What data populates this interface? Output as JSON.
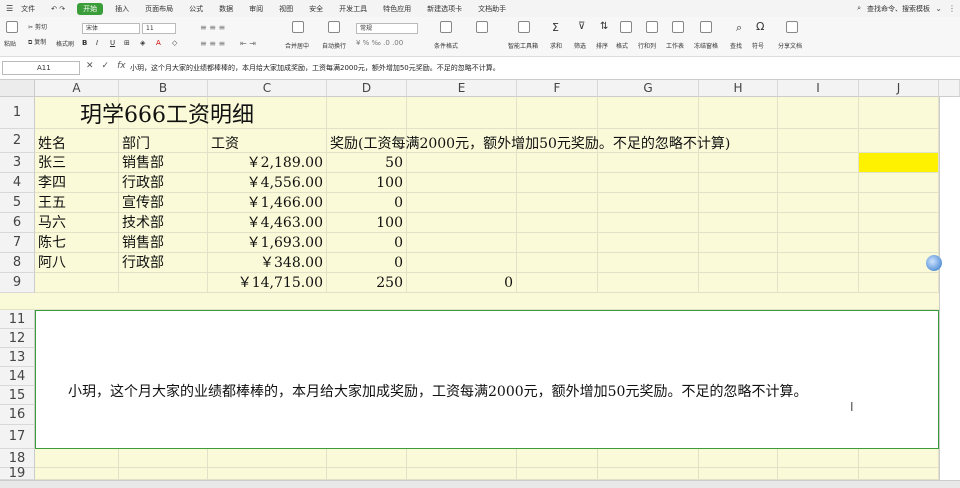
{
  "menu": {
    "file_label": "文件",
    "tabs": [
      "开始",
      "插入",
      "页面布局",
      "公式",
      "数据",
      "审阅",
      "视图",
      "安全",
      "开发工具",
      "特色应用",
      "新建选项卡",
      "文档助手"
    ],
    "active_tab": "开始",
    "search_label": "查找命令、搜索模板"
  },
  "ribbon": {
    "paste": "粘贴",
    "cut": "剪切",
    "copy": "复制",
    "format_painter": "格式刷",
    "font_name": "宋体",
    "font_size": "11",
    "number_format": "常规",
    "merge_center": "合并居中",
    "wrap": "自动换行",
    "cond_format": "条件格式",
    "smart_toolbox": "智能工具箱",
    "sum": "求和",
    "filter": "筛选",
    "sort": "排序",
    "format": "格式",
    "rowcol": "行和列",
    "worksheet": "工作表",
    "freeze": "冻结窗格",
    "find": "查找",
    "symbol": "符号",
    "share": "分享文档"
  },
  "formula_bar": {
    "cell_ref": "A11",
    "content": "小玥，这个月大家的业绩都棒棒的，本月给大家加成奖励，工资每满2000元，额外增加50元奖励。不足的忽略不计算。"
  },
  "columns": [
    "A",
    "B",
    "C",
    "D",
    "E",
    "F",
    "G",
    "H",
    "I",
    "J"
  ],
  "rows": [
    "1",
    "2",
    "3",
    "4",
    "5",
    "6",
    "7",
    "8",
    "9",
    "11",
    "12",
    "13",
    "14",
    "15",
    "16",
    "17",
    "18",
    "19"
  ],
  "sheet": {
    "title": "玥学666工资明细",
    "headers": {
      "name": "姓名",
      "dept": "部门",
      "salary": "工资",
      "bonus": "奖励(工资每满2000元，额外增加50元奖励。不足的忽略不计算)"
    },
    "records": [
      {
        "name": "张三",
        "dept": "销售部",
        "salary": "￥2,189.00",
        "bonus": "50"
      },
      {
        "name": "李四",
        "dept": "行政部",
        "salary": "￥4,556.00",
        "bonus": "100"
      },
      {
        "name": "王五",
        "dept": "宣传部",
        "salary": "￥1,466.00",
        "bonus": "0"
      },
      {
        "name": "马六",
        "dept": "技术部",
        "salary": "￥4,463.00",
        "bonus": "100"
      },
      {
        "name": "陈七",
        "dept": "销售部",
        "salary": "￥1,693.00",
        "bonus": "0"
      },
      {
        "name": "阿八",
        "dept": "行政部",
        "salary": "￥348.00",
        "bonus": "0"
      }
    ],
    "totals": {
      "salary": "￥14,715.00",
      "bonus": "250",
      "e": "0"
    }
  },
  "textbox": {
    "text": "小玥，这个月大家的业绩都棒棒的，本月给大家加成奖励，工资每满2000元，额外增加50元奖励。不足的忽略不计算。"
  },
  "colors": {
    "accent": "#3a9d3a",
    "sheet_bg": "#fafad8",
    "highlight": "#fff200"
  }
}
